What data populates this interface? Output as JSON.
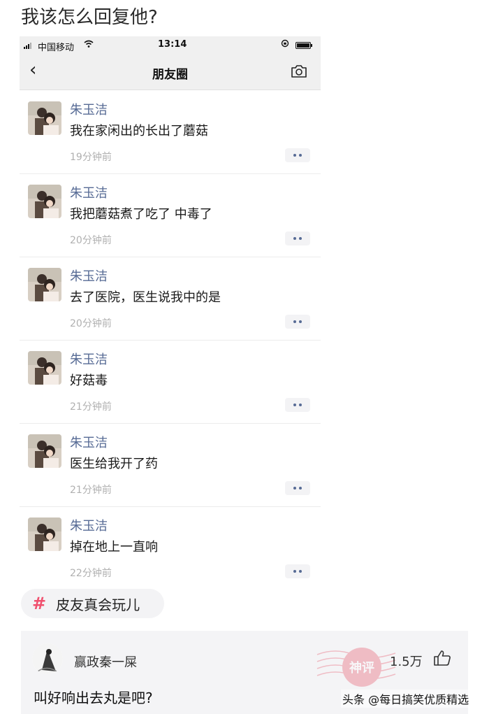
{
  "question": "我该怎么回复他?",
  "status_bar": {
    "carrier": "中国移动",
    "time": "13:14"
  },
  "nav": {
    "back": "‹",
    "title": "朋友圈"
  },
  "messages": [
    {
      "name": "朱玉洁",
      "text": "我在家闲出的长出了蘑菇",
      "time": "19分钟前"
    },
    {
      "name": "朱玉洁",
      "text": "我把蘑菇煮了吃了  中毒了",
      "time": "20分钟前"
    },
    {
      "name": "朱玉洁",
      "text": "去了医院，医生说我中的是",
      "time": "20分钟前"
    },
    {
      "name": "朱玉洁",
      "text": "好菇毒",
      "time": "21分钟前"
    },
    {
      "name": "朱玉洁",
      "text": "医生给我开了药",
      "time": "21分钟前"
    },
    {
      "name": "朱玉洁",
      "text": "掉在地上一直响",
      "time": "22分钟前"
    }
  ],
  "tag": {
    "symbol": "#",
    "label": "皮友真会玩儿"
  },
  "comment": {
    "username": "赢政秦一屎",
    "likes": "1.5万",
    "text": "叫好响出去丸是吧?",
    "stamp": "神评"
  },
  "watermark": "头条 @每日搞笑优质精选",
  "colors": {
    "name_blue": "#576b95",
    "tag_pink": "#f0506e",
    "stamp_pink": "#e8556a"
  },
  "icons": [
    "signal-icon",
    "wifi-icon",
    "lock-rotation-icon",
    "battery-icon",
    "back-icon",
    "camera-icon",
    "more-icon",
    "hashtag-icon",
    "thumb-up-icon"
  ]
}
